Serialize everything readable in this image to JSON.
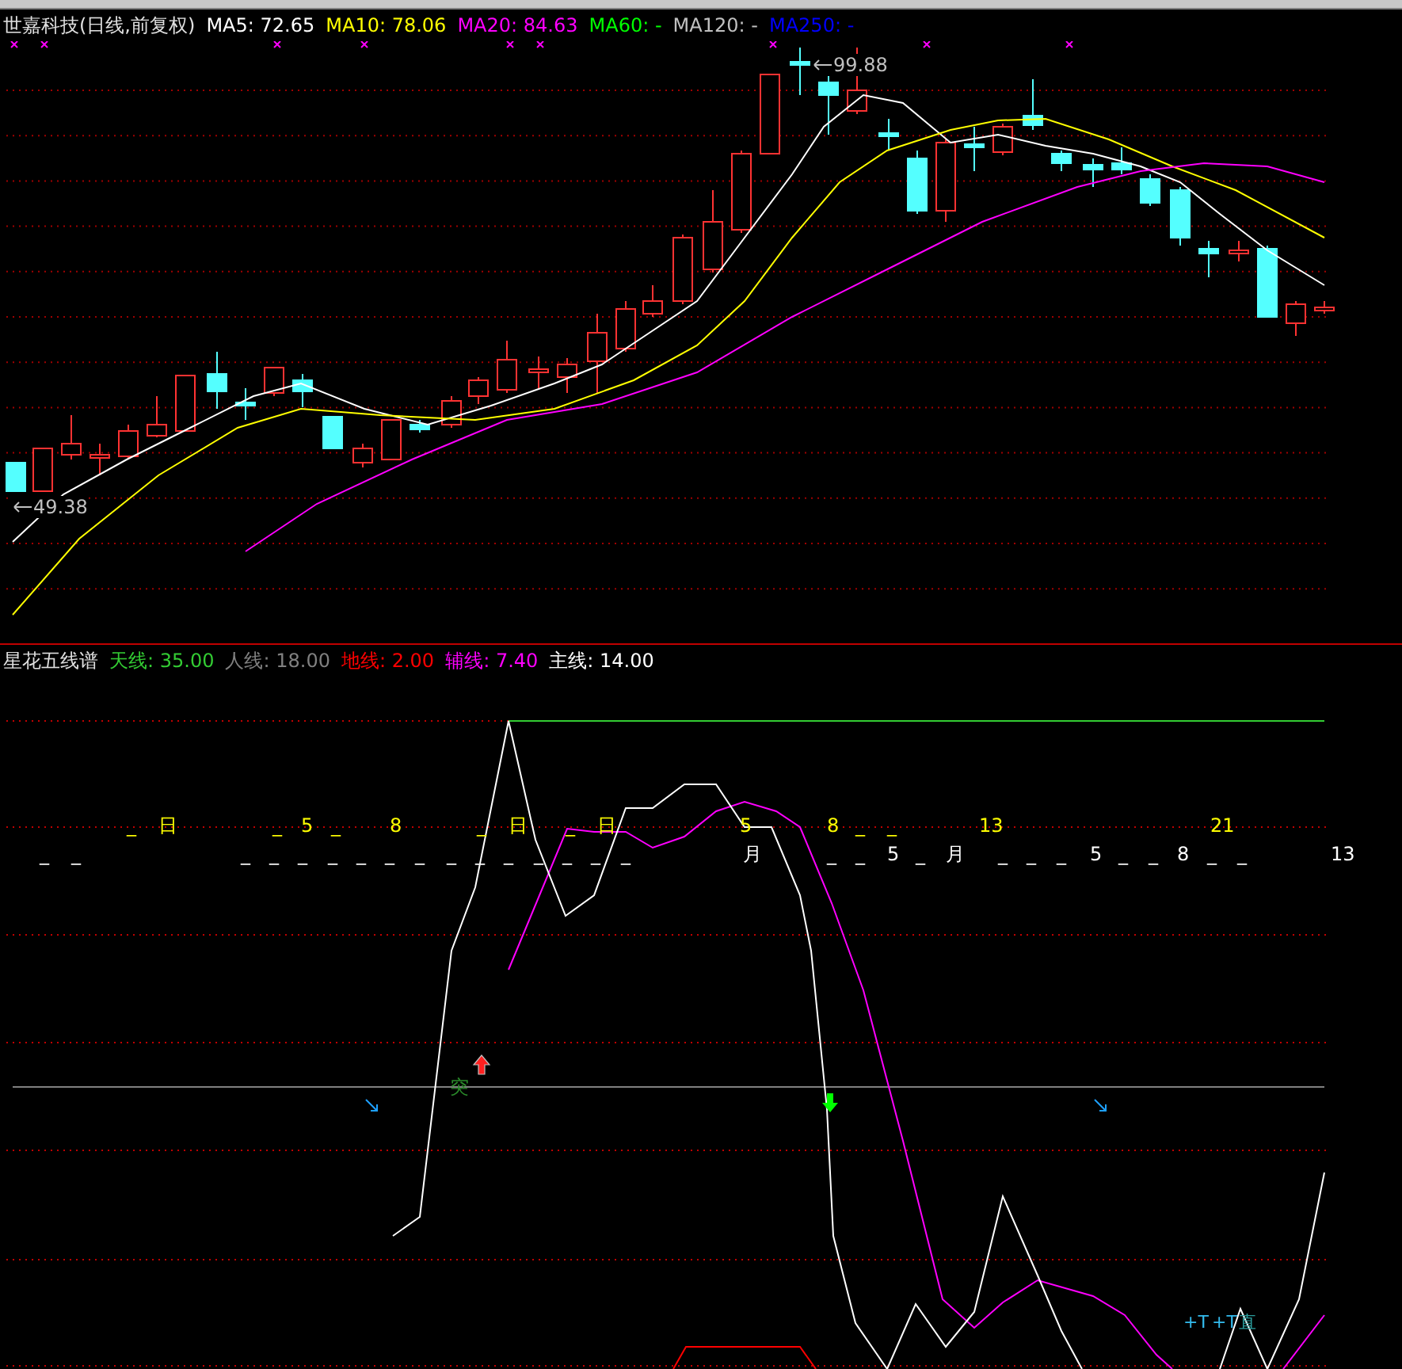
{
  "price_panel": {
    "title": "世嘉科技(日线,前复权)",
    "moving_averages": [
      {
        "label": "MA5:",
        "value": "72.65",
        "color": "#ffffff"
      },
      {
        "label": "MA10:",
        "value": "78.06",
        "color": "#ffff00"
      },
      {
        "label": "MA20:",
        "value": "84.63",
        "color": "#ff00ff"
      },
      {
        "label": "MA60:",
        "value": "-",
        "color": "#00ff00"
      },
      {
        "label": "MA120:",
        "value": "-",
        "color": "#c0c0c0"
      },
      {
        "label": "MA250:",
        "value": "-",
        "color": "#0000ff"
      }
    ],
    "high_label": "99.88",
    "low_label": "49.38"
  },
  "indicator_panel": {
    "title": "星花五线谱",
    "lines": [
      {
        "label": "天线:",
        "value": "35.00",
        "color": "#33cc33"
      },
      {
        "label": "人线:",
        "value": "18.00",
        "color": "#808080"
      },
      {
        "label": "地线:",
        "value": "2.00",
        "color": "#ff0000"
      },
      {
        "label": "辅线:",
        "value": "7.40",
        "color": "#ff00ff"
      },
      {
        "label": "主线:",
        "value": "14.00",
        "color": "#ffffff"
      }
    ],
    "marks": [
      {
        "text": "_",
        "color": "#ffff00"
      },
      {
        "text": "日",
        "color": "#ffff00"
      },
      {
        "text": "_",
        "color": "#ffff00"
      },
      {
        "text": "5",
        "color": "#ffff00"
      },
      {
        "text": "_",
        "color": "#ffff00"
      },
      {
        "text": "8",
        "color": "#ffff00"
      },
      {
        "text": "_",
        "color": "#ffff00"
      },
      {
        "text": "日",
        "color": "#ffff00"
      },
      {
        "text": "_",
        "color": "#ffff00"
      },
      {
        "text": "日",
        "color": "#ffff00"
      },
      {
        "text": "5",
        "color": "#ffff00"
      },
      {
        "text": "8",
        "color": "#ffff00"
      },
      {
        "text": "_",
        "color": "#ffff00"
      },
      {
        "text": "_",
        "color": "#ffff00"
      },
      {
        "text": "13",
        "color": "#ffff00"
      },
      {
        "text": "21",
        "color": "#ffff00"
      },
      {
        "text": "_",
        "color": "#ffffff"
      },
      {
        "text": "_",
        "color": "#ffffff"
      },
      {
        "text": "_",
        "color": "#ffffff"
      },
      {
        "text": "_",
        "color": "#ffffff"
      },
      {
        "text": "_",
        "color": "#ffffff"
      },
      {
        "text": "_",
        "color": "#ffffff"
      },
      {
        "text": "_",
        "color": "#ffffff"
      },
      {
        "text": "_",
        "color": "#ffffff"
      },
      {
        "text": "_",
        "color": "#ffffff"
      },
      {
        "text": "_",
        "color": "#ffffff"
      },
      {
        "text": "_",
        "color": "#ffffff"
      },
      {
        "text": "_",
        "color": "#ffffff"
      },
      {
        "text": "_",
        "color": "#ffffff"
      },
      {
        "text": "_",
        "color": "#ffffff"
      },
      {
        "text": "_",
        "color": "#ffffff"
      },
      {
        "text": "_",
        "color": "#ffffff"
      },
      {
        "text": "月",
        "color": "#ffffff"
      },
      {
        "text": "_",
        "color": "#ffffff"
      },
      {
        "text": "_",
        "color": "#ffffff"
      },
      {
        "text": "5",
        "color": "#ffffff"
      },
      {
        "text": "_",
        "color": "#ffffff"
      },
      {
        "text": "月",
        "color": "#ffffff"
      },
      {
        "text": "_",
        "color": "#ffffff"
      },
      {
        "text": "_",
        "color": "#ffffff"
      },
      {
        "text": "_",
        "color": "#ffffff"
      },
      {
        "text": "5",
        "color": "#ffffff"
      },
      {
        "text": "_",
        "color": "#ffffff"
      },
      {
        "text": "_",
        "color": "#ffffff"
      },
      {
        "text": "8",
        "color": "#ffffff"
      },
      {
        "text": "_",
        "color": "#ffffff"
      },
      {
        "text": "_",
        "color": "#ffffff"
      },
      {
        "text": "13",
        "color": "#ffffff"
      }
    ],
    "signal_text": "突",
    "footer_marks": [
      {
        "text": "+T",
        "color": "#33bbee"
      },
      {
        "text": "+T",
        "color": "#33bbee"
      },
      {
        "text": "直",
        "color": "#2a9a9a"
      }
    ]
  }
}
